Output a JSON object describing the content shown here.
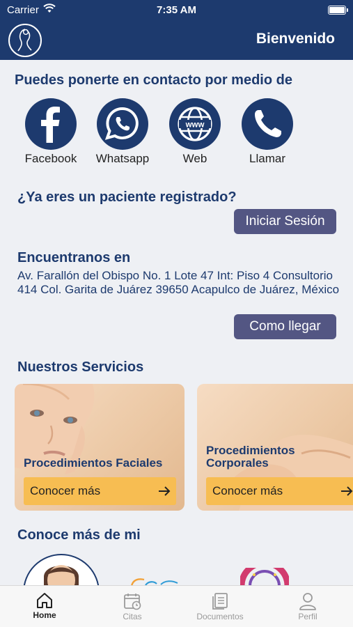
{
  "status_bar": {
    "carrier": "Carrier",
    "time": "7:35 AM"
  },
  "nav": {
    "title": "Bienvenido"
  },
  "contact": {
    "title": "Puedes ponerte en contacto por medio de",
    "items": [
      {
        "label": "Facebook",
        "icon": "facebook-icon"
      },
      {
        "label": "Whatsapp",
        "icon": "whatsapp-icon"
      },
      {
        "label": "Web",
        "icon": "globe-icon"
      },
      {
        "label": "Llamar",
        "icon": "phone-icon"
      }
    ]
  },
  "registered": {
    "title": "¿Ya eres un paciente registrado?",
    "button": "Iniciar Sesión"
  },
  "location": {
    "title": "Encuentranos en",
    "address": "Av. Farallón del Obispo No. 1 Lote 47 Int: Piso 4 Consultorio 414 Col. Garita de Juárez 39650 Acapulco de Juárez, México",
    "button": "Como llegar"
  },
  "services": {
    "title": "Nuestros Servicios",
    "cards": [
      {
        "name": "Procedimientos Faciales",
        "cta": "Conocer más"
      },
      {
        "name": "Procedimientos Corporales",
        "cta": "Conocer más"
      }
    ]
  },
  "about": {
    "title": "Conoce más de mi"
  },
  "tabs": [
    {
      "label": "Home",
      "icon": "home-icon",
      "active": true
    },
    {
      "label": "Citas",
      "icon": "calendar-icon",
      "active": false
    },
    {
      "label": "Documentos",
      "icon": "documents-icon",
      "active": false
    },
    {
      "label": "Perfil",
      "icon": "user-icon",
      "active": false
    }
  ],
  "colors": {
    "primary": "#1d3a6e",
    "button": "#535683",
    "accent": "#f7bd52",
    "background": "#eef0f4"
  }
}
